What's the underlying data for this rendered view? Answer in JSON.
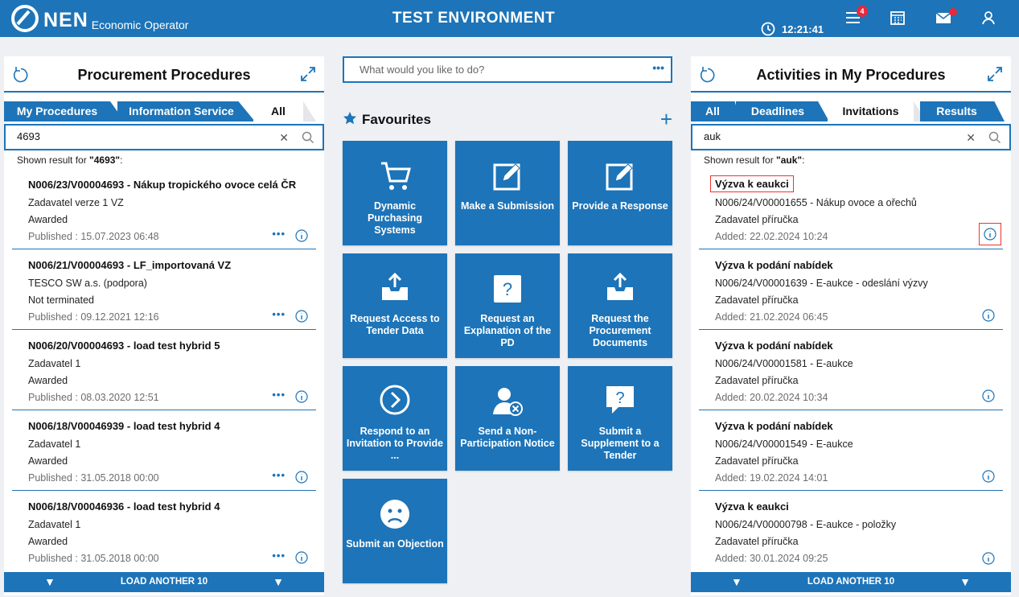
{
  "header": {
    "logo_text": "NEN",
    "logo_sub": "Economic Operator",
    "environment": "TEST ENVIRONMENT",
    "clock": "12:21:41",
    "menu_badge": "4"
  },
  "left": {
    "title": "Procurement Procedures",
    "tabs": [
      "My Procedures",
      "Information Service",
      "All"
    ],
    "search_value": "4693",
    "shown_prefix": "Shown result for ",
    "shown_query": "\"4693\"",
    "shown_suffix": ":",
    "items": [
      {
        "title": "N006/23/V00004693 - Nákup tropického ovoce celá ČR",
        "sub": "Zadavatel verze 1 VZ",
        "status": "Awarded",
        "date": "Published : 15.07.2023 06:48"
      },
      {
        "title": "N006/21/V00004693 - LF_importovaná VZ",
        "sub": "TESCO SW a.s. (podpora)",
        "status": "Not terminated",
        "date": "Published : 09.12.2021 12:16"
      },
      {
        "title": "N006/20/V00004693 - load test hybrid 5",
        "sub": "Zadavatel 1",
        "status": "Awarded",
        "date": "Published : 08.03.2020 12:51"
      },
      {
        "title": "N006/18/V00046939 - load test hybrid 4",
        "sub": "Zadavatel 1",
        "status": "Awarded",
        "date": "Published : 31.05.2018 00:00"
      },
      {
        "title": "N006/18/V00046936 - load test hybrid 4",
        "sub": "Zadavatel 1",
        "status": "Awarded",
        "date": "Published : 31.05.2018 00:00"
      }
    ],
    "more_dots": "•••",
    "load_more": "LOAD ANOTHER 10"
  },
  "center": {
    "search_placeholder": "What would you like to do?",
    "more_dots": "•••",
    "favourites_title": "Favourites",
    "add": "+",
    "tiles": [
      {
        "label": "Dynamic Purchasing Systems",
        "icon": "cart-icon"
      },
      {
        "label": "Make a Submission",
        "icon": "edit-icon"
      },
      {
        "label": "Provide a Response",
        "icon": "edit-icon"
      },
      {
        "label": "Request Access to Tender Data",
        "icon": "upload-tray-icon"
      },
      {
        "label": "Request an Explanation of the PD",
        "icon": "question-box-icon"
      },
      {
        "label": "Request the Procurement Documents",
        "icon": "upload-tray-icon"
      },
      {
        "label": "Respond to an Invitation to Provide ...",
        "icon": "chevron-circle-icon"
      },
      {
        "label": "Send a Non-Participation Notice",
        "icon": "user-x-icon"
      },
      {
        "label": "Submit a Supplement to a Tender",
        "icon": "question-bubble-icon"
      },
      {
        "label": "Submit an Objection",
        "icon": "sad-face-icon"
      }
    ]
  },
  "right": {
    "title": "Activities in My Procedures",
    "tabs": [
      "All",
      "Deadlines",
      "Invitations",
      "Results"
    ],
    "search_value": "auk",
    "shown_prefix": "Shown result for ",
    "shown_query": "\"auk\"",
    "shown_suffix": ":",
    "items": [
      {
        "title": "Výzva k eaukci",
        "sub": "N006/24/V00001655 - Nákup ovoce a ořechů",
        "org": "Zadavatel příručka",
        "date": "Added: 22.02.2024 10:24"
      },
      {
        "title": "Výzva k podání nabídek",
        "sub": "N006/24/V00001639 - E-aukce - odeslání výzvy",
        "org": "Zadavatel příručka",
        "date": "Added: 21.02.2024 06:45"
      },
      {
        "title": "Výzva k podání nabídek",
        "sub": "N006/24/V00001581 - E-aukce",
        "org": "Zadavatel příručka",
        "date": "Added: 20.02.2024 10:34"
      },
      {
        "title": "Výzva k podání nabídek",
        "sub": "N006/24/V00001549 - E-aukce",
        "org": "Zadavatel příručka",
        "date": "Added: 19.02.2024 14:01"
      },
      {
        "title": "Výzva k eaukci",
        "sub": "N006/24/V00000798 - E-aukce - položky",
        "org": "Zadavatel příručka",
        "date": "Added: 30.01.2024 09:25"
      }
    ],
    "load_more": "LOAD ANOTHER 10"
  }
}
